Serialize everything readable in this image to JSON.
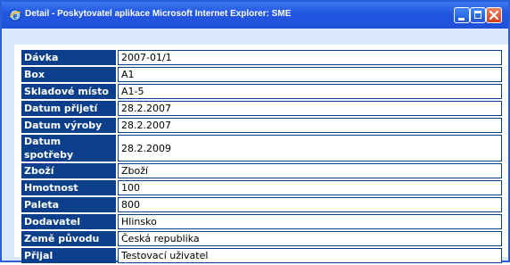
{
  "window": {
    "title": "Detail - Poskytovatel aplikace Microsoft Internet Explorer: SME",
    "app_icon": "ie-icon",
    "controls": {
      "minimize": "minimize-icon",
      "maximize": "maximize-icon",
      "close": "close-icon"
    }
  },
  "colors": {
    "label_bg": "#0b3f8c",
    "titlebar": "#2458e3",
    "window_bg": "#dbe7fb"
  },
  "rows": [
    {
      "label": "Dávka",
      "value": "2007-01/1"
    },
    {
      "label": "Box",
      "value": "A1"
    },
    {
      "label": "Skladové místo",
      "value": "A1-5"
    },
    {
      "label": "Datum přijetí",
      "value": "28.2.2007"
    },
    {
      "label": "Datum výroby",
      "value": "28.2.2007"
    },
    {
      "label": "Datum spotřeby",
      "value": "28.2.2009"
    },
    {
      "label": "Zboží",
      "value": "Zboží"
    },
    {
      "label": "Hmotnost",
      "value": "100"
    },
    {
      "label": "Paleta",
      "value": "800"
    },
    {
      "label": "Dodavatel",
      "value": "Hlinsko"
    },
    {
      "label": "Země původu",
      "value": "Česká republika"
    },
    {
      "label": "Přijal",
      "value": "Testovací uživatel"
    }
  ]
}
